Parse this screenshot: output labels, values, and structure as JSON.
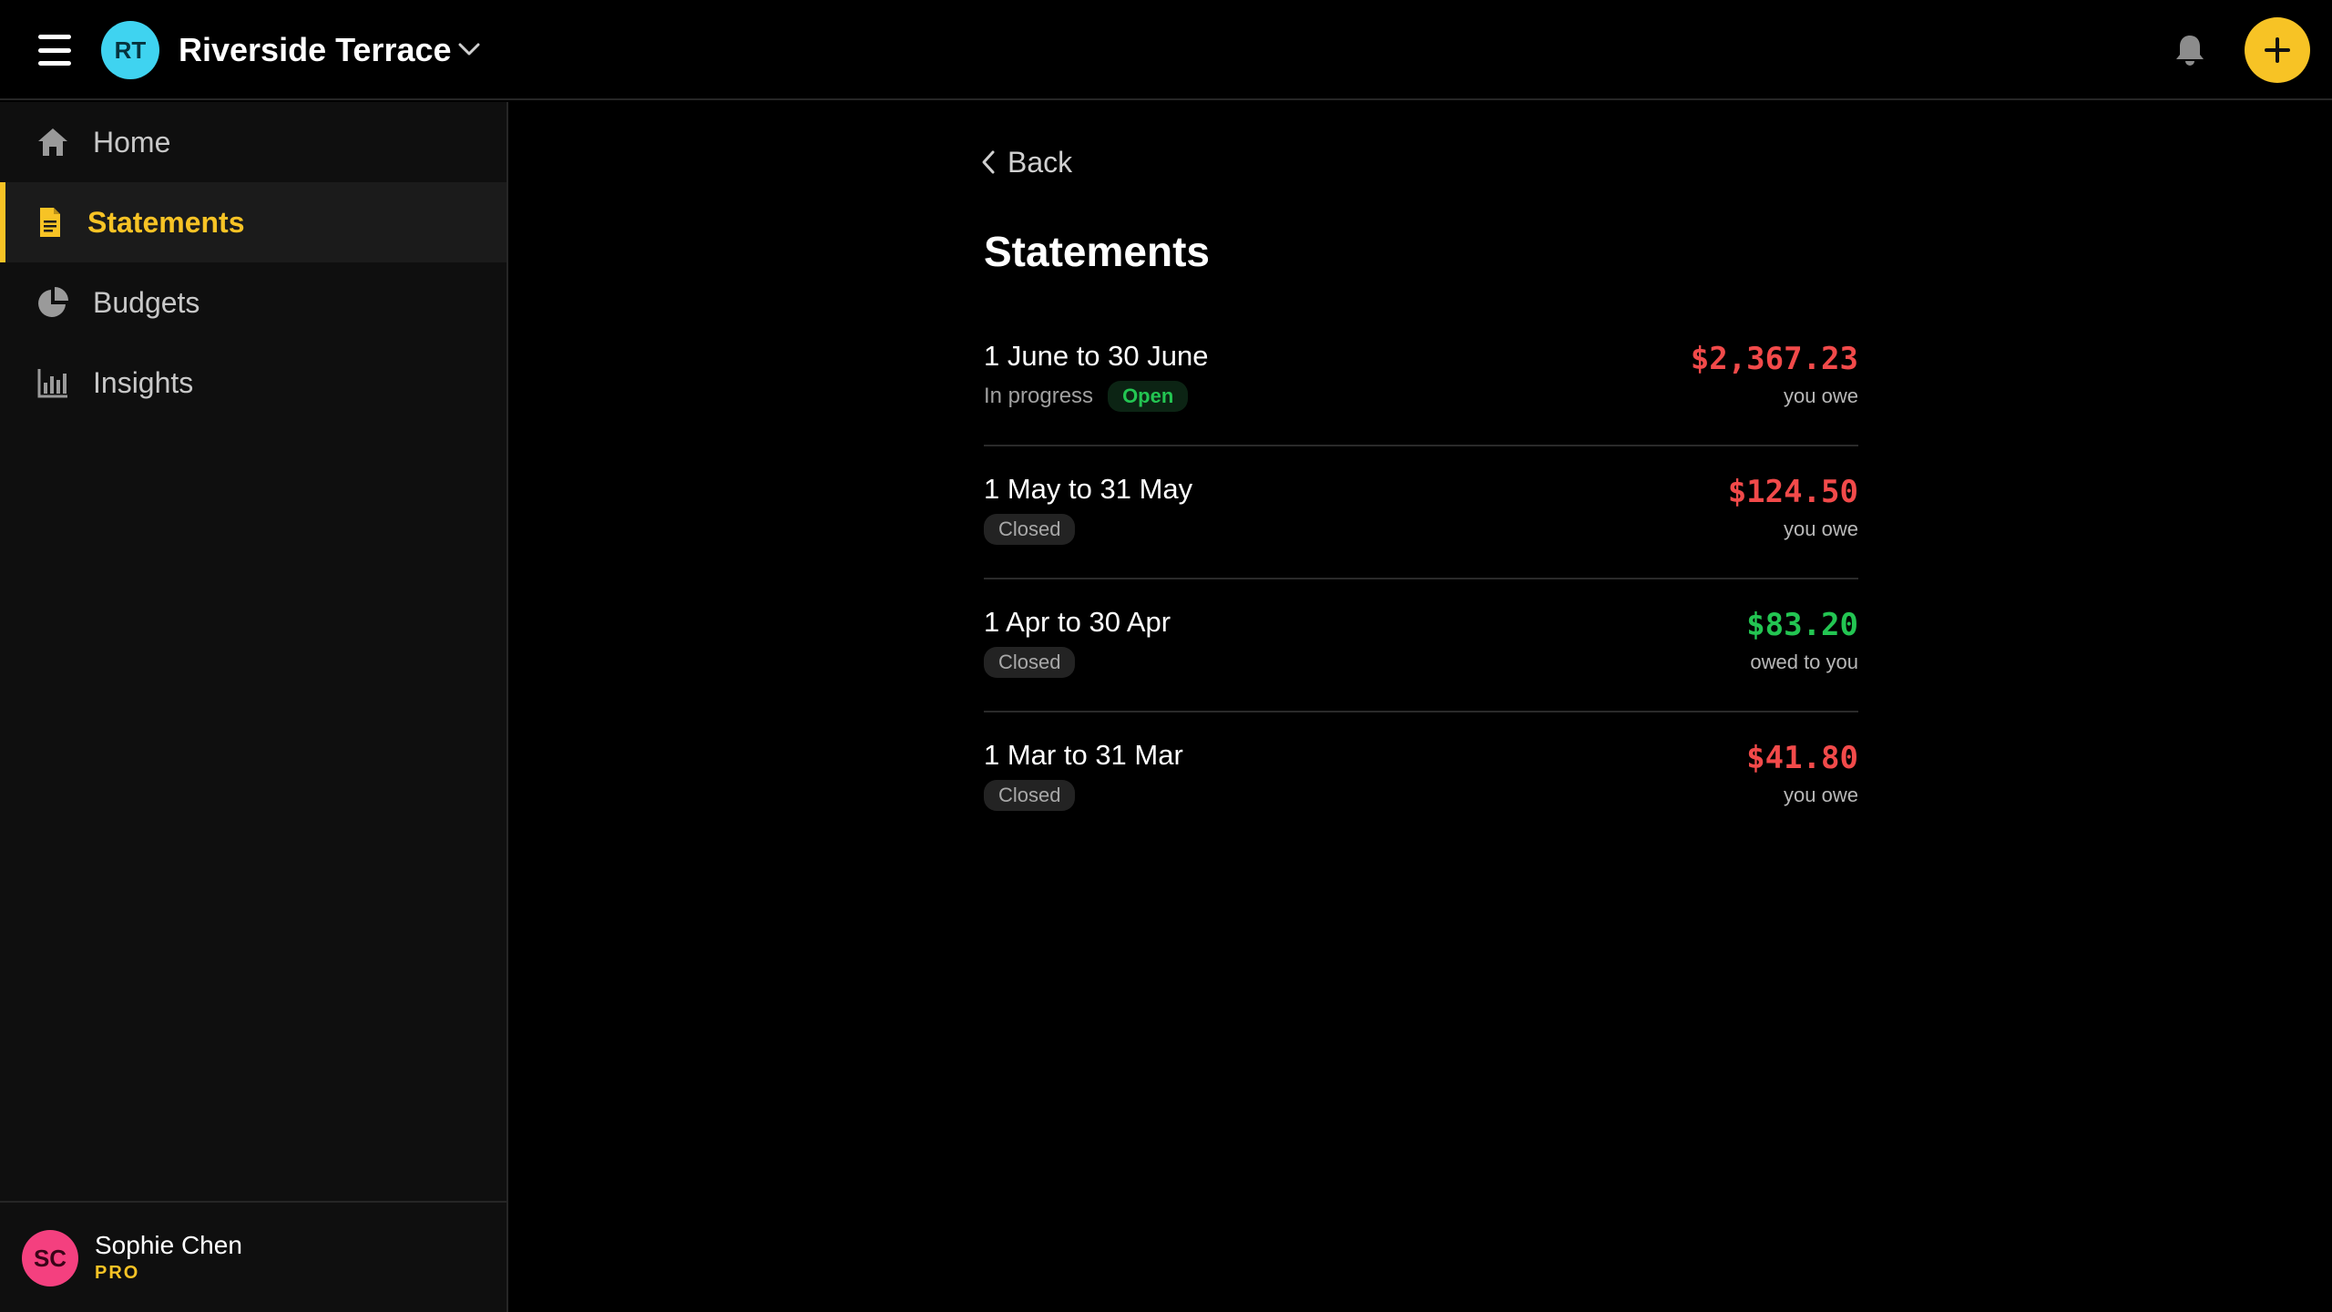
{
  "header": {
    "org_initials": "RT",
    "org_name": "Riverside Terrace",
    "org_avatar_color": "#3fd3f0",
    "menu_icon": "hamburger-icon",
    "bell_icon": "bell-icon",
    "add_icon": "plus-icon",
    "accent_color": "#f7c325"
  },
  "sidebar": {
    "items": [
      {
        "label": "Home",
        "icon": "home-icon",
        "active": false
      },
      {
        "label": "Statements",
        "icon": "document-icon",
        "active": true
      },
      {
        "label": "Budgets",
        "icon": "pie-chart-icon",
        "active": false
      },
      {
        "label": "Insights",
        "icon": "bar-chart-icon",
        "active": false
      }
    ],
    "user": {
      "initials": "SC",
      "name": "Sophie Chen",
      "plan": "PRO",
      "avatar_color": "#f4407f"
    }
  },
  "main": {
    "back_label": "Back",
    "title": "Statements",
    "statements": [
      {
        "period": "1 June to 30 June",
        "subtitle": "In progress",
        "status": "Open",
        "amount": "$2,367.23",
        "direction": "you owe",
        "amount_color": "#f24a4a"
      },
      {
        "period": "1 May to 31 May",
        "subtitle": "",
        "status": "Closed",
        "amount": "$124.50",
        "direction": "you owe",
        "amount_color": "#f24a4a"
      },
      {
        "period": "1 Apr to 30 Apr",
        "subtitle": "",
        "status": "Closed",
        "amount": "$83.20",
        "direction": "owed to you",
        "amount_color": "#23c552"
      },
      {
        "period": "1 Mar to 31 Mar",
        "subtitle": "",
        "status": "Closed",
        "amount": "$41.80",
        "direction": "you owe",
        "amount_color": "#f24a4a"
      }
    ]
  }
}
